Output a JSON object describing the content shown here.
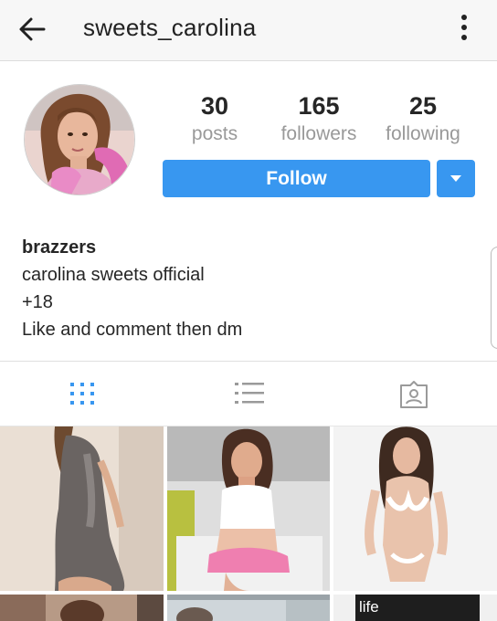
{
  "header": {
    "back_icon": "arrow-left-icon",
    "username": "sweets_carolina",
    "more_icon": "vertical-ellipsis-icon"
  },
  "profile": {
    "stats": {
      "posts": {
        "value": "30",
        "label": "posts"
      },
      "followers": {
        "value": "165",
        "label": "followers"
      },
      "following": {
        "value": "25",
        "label": "following"
      }
    },
    "follow_label": "Follow",
    "dropdown_icon": "caret-down-icon",
    "accent_color": "#3897f0"
  },
  "bio": {
    "name": "brazzers",
    "lines": [
      "carolina sweets official",
      "+18",
      "Like and comment then dm"
    ]
  },
  "tabs": [
    {
      "icon": "grid-icon",
      "active": true,
      "active_color": "#3897f0"
    },
    {
      "icon": "list-icon",
      "active": false
    },
    {
      "icon": "tagged-photos-icon",
      "active": false
    }
  ],
  "photos": {
    "partial_caption": "life"
  }
}
